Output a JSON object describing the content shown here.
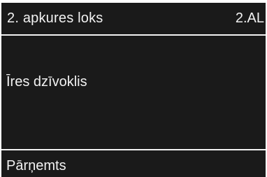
{
  "header": {
    "title": "2. apkures loks",
    "code": "2.AL"
  },
  "main": {
    "value": "Īres dzīvoklis"
  },
  "footer": {
    "status": "Pārņemts"
  }
}
